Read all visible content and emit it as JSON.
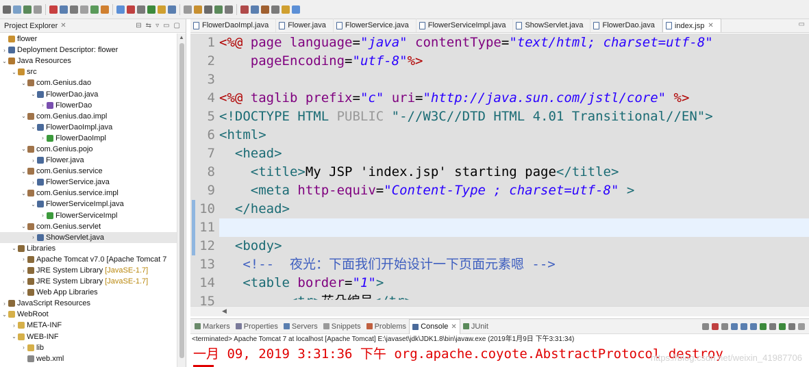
{
  "explorer": {
    "title": "Project Explorer",
    "tree": [
      {
        "label": "flower",
        "level": 0,
        "arrow": "",
        "icon": "project-icon"
      },
      {
        "label": "Deployment Descriptor: flower",
        "level": 0,
        "arrow": ">",
        "icon": "descriptor-icon"
      },
      {
        "label": "Java Resources",
        "level": 0,
        "arrow": "v",
        "icon": "java-resources-icon"
      },
      {
        "label": "src",
        "level": 1,
        "arrow": "v",
        "icon": "source-folder-icon"
      },
      {
        "label": "com.Genius.dao",
        "level": 2,
        "arrow": "v",
        "icon": "package-icon"
      },
      {
        "label": "FlowerDao.java",
        "level": 3,
        "arrow": "v",
        "icon": "java-file-icon"
      },
      {
        "label": "FlowerDao",
        "level": 4,
        "arrow": ">",
        "icon": "interface-icon"
      },
      {
        "label": "com.Genius.dao.impl",
        "level": 2,
        "arrow": "v",
        "icon": "package-icon"
      },
      {
        "label": "FlowerDaoImpl.java",
        "level": 3,
        "arrow": "v",
        "icon": "java-file-icon"
      },
      {
        "label": "FlowerDaoImpl",
        "level": 4,
        "arrow": ">",
        "icon": "class-icon"
      },
      {
        "label": "com.Genius.pojo",
        "level": 2,
        "arrow": "v",
        "icon": "package-icon"
      },
      {
        "label": "Flower.java",
        "level": 3,
        "arrow": ">",
        "icon": "java-file-icon"
      },
      {
        "label": "com.Genius.service",
        "level": 2,
        "arrow": "v",
        "icon": "package-icon"
      },
      {
        "label": "FlowerService.java",
        "level": 3,
        "arrow": ">",
        "icon": "java-file-icon"
      },
      {
        "label": "com.Genius.service.impl",
        "level": 2,
        "arrow": "v",
        "icon": "package-icon"
      },
      {
        "label": "FlowerServiceImpl.java",
        "level": 3,
        "arrow": "v",
        "icon": "java-file-icon"
      },
      {
        "label": "FlowerServiceImpl",
        "level": 4,
        "arrow": ">",
        "icon": "class-icon"
      },
      {
        "label": "com.Genius.servlet",
        "level": 2,
        "arrow": "v",
        "icon": "package-icon"
      },
      {
        "label": "ShowServlet.java",
        "level": 3,
        "arrow": ">",
        "icon": "java-file-icon",
        "selected": true
      },
      {
        "label": "Libraries",
        "level": 1,
        "arrow": "v",
        "icon": "library-icon"
      },
      {
        "label": "Apache Tomcat v7.0 [Apache Tomcat 7",
        "level": 2,
        "arrow": ">",
        "icon": "library-icon"
      },
      {
        "label": "JRE System Library",
        "deco": "[JavaSE-1.7]",
        "level": 2,
        "arrow": ">",
        "icon": "library-icon"
      },
      {
        "label": "JRE System Library",
        "deco": "[JavaSE-1.7]",
        "level": 2,
        "arrow": ">",
        "icon": "library-icon"
      },
      {
        "label": "Web App Libraries",
        "level": 2,
        "arrow": ">",
        "icon": "library-icon"
      },
      {
        "label": "JavaScript Resources",
        "level": 0,
        "arrow": ">",
        "icon": "library-icon"
      },
      {
        "label": "WebRoot",
        "level": 0,
        "arrow": "v",
        "icon": "folder-icon"
      },
      {
        "label": "META-INF",
        "level": 1,
        "arrow": ">",
        "icon": "folder-icon"
      },
      {
        "label": "WEB-INF",
        "level": 1,
        "arrow": "v",
        "icon": "folder-icon"
      },
      {
        "label": "lib",
        "level": 2,
        "arrow": ">",
        "icon": "folder-icon"
      },
      {
        "label": "web.xml",
        "level": 2,
        "arrow": "",
        "icon": "xml-file-icon"
      }
    ]
  },
  "editor": {
    "tabs": [
      {
        "label": "FlowerDaoImpl.java",
        "active": false
      },
      {
        "label": "Flower.java",
        "active": false
      },
      {
        "label": "FlowerService.java",
        "active": false
      },
      {
        "label": "FlowerServiceImpl.java",
        "active": false
      },
      {
        "label": "ShowServlet.java",
        "active": false
      },
      {
        "label": "FlowerDao.java",
        "active": false
      },
      {
        "label": "index.jsp",
        "active": true
      }
    ],
    "line_numbers": [
      "1",
      "2",
      "3",
      "4",
      "5",
      "6",
      "7",
      "8",
      "9",
      "10",
      "11",
      "12",
      "13",
      "14",
      "15"
    ],
    "current_line": 11,
    "lines": [
      [
        [
          "k-dir",
          "<%@ "
        ],
        [
          "k-attr",
          "page "
        ],
        [
          "k-attr",
          "language"
        ],
        [
          "",
          "="
        ],
        [
          "k-str",
          "\"java\""
        ],
        [
          "",
          ""
        ],
        [
          "k-attr",
          " contentType"
        ],
        [
          "",
          "="
        ],
        [
          "k-str",
          "\"text/html; charset=utf-8\""
        ]
      ],
      [
        [
          "",
          "    "
        ],
        [
          "k-attr",
          "pageEncoding"
        ],
        [
          "",
          "="
        ],
        [
          "k-str",
          "\"utf-8\""
        ],
        [
          "k-dir",
          "%>"
        ]
      ],
      [],
      [
        [
          "k-dir",
          "<%@ "
        ],
        [
          "k-attr",
          "taglib "
        ],
        [
          "k-attr",
          "prefix"
        ],
        [
          "",
          "="
        ],
        [
          "k-str",
          "\"c\""
        ],
        [
          "k-attr",
          " uri"
        ],
        [
          "",
          "="
        ],
        [
          "k-str",
          "\"http://java.sun.com/jstl/core\""
        ],
        [
          "k-dir",
          " %>"
        ]
      ],
      [
        [
          "k-doc",
          "<!DOCTYPE HTML "
        ],
        [
          "k-grey",
          "PUBLIC "
        ],
        [
          "k-doc",
          "\"-//W3C//DTD HTML 4.01 Transitional//EN\">"
        ]
      ],
      [
        [
          "k-tag",
          "<html>"
        ]
      ],
      [
        [
          "k-tag",
          "  <head>"
        ]
      ],
      [
        [
          "k-tag",
          "    <title>"
        ],
        [
          "",
          "My JSP 'index.jsp' starting page"
        ],
        [
          "k-tag",
          "</title>"
        ]
      ],
      [
        [
          "k-tag",
          "    <meta "
        ],
        [
          "k-attr",
          "http-equiv"
        ],
        [
          "",
          "="
        ],
        [
          "k-str",
          "\"Content-Type ; charset=utf-8\""
        ],
        [
          "k-tag",
          " >"
        ]
      ],
      [
        [
          "k-tag",
          "  </head>"
        ]
      ],
      [],
      [
        [
          "k-tag",
          "  <body>"
        ]
      ],
      [
        [
          "k-cmt",
          "   <!--  夜光：下面我们开始设计一下页面元素嗯 -->"
        ]
      ],
      [
        [
          "k-tag",
          "   <table "
        ],
        [
          "k-attr",
          "border"
        ],
        [
          "",
          "="
        ],
        [
          "k-str",
          "\"1\""
        ],
        [
          "k-tag",
          ">"
        ]
      ],
      [
        [
          "k-tag",
          "         <tr>"
        ],
        [
          "",
          "花朵编号"
        ],
        [
          "k-tag",
          "</tr>"
        ]
      ]
    ]
  },
  "console": {
    "tabs": [
      {
        "label": "Markers",
        "icon": "markers-icon",
        "active": false
      },
      {
        "label": "Properties",
        "icon": "properties-icon",
        "active": false
      },
      {
        "label": "Servers",
        "icon": "servers-icon",
        "active": false
      },
      {
        "label": "Snippets",
        "icon": "snippets-icon",
        "active": false
      },
      {
        "label": "Problems",
        "icon": "problems-icon",
        "active": false
      },
      {
        "label": "Console",
        "icon": "console-icon",
        "active": true
      },
      {
        "label": "JUnit",
        "icon": "junit-icon",
        "active": false
      }
    ],
    "terminated": "<terminated> Apache Tomcat 7 at localhost [Apache Tomcat] E:\\javaset\\jdk\\JDK1.8\\bin\\javaw.exe (2019年1月9日 下午3:31:34)",
    "output": "一月 09, 2019 3:31:36 下午 org.apache.coyote.AbstractProtocol destroy",
    "watermark": "https://blog.csdn.net/weixin_41987706"
  },
  "colors": {
    "error_red": "#e00000",
    "editor_bg": "#e0e0e0",
    "current_line": "#e8f2fe"
  }
}
